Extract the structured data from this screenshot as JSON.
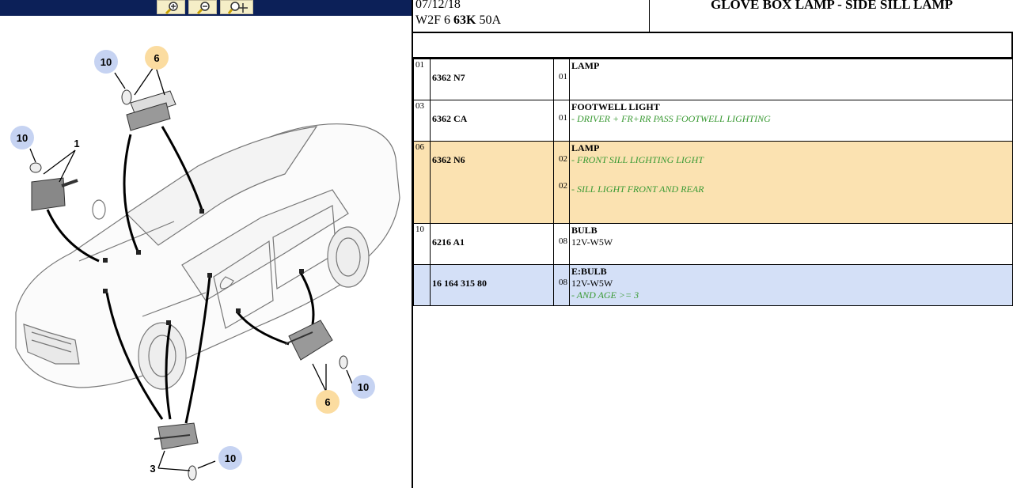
{
  "toolbar": {
    "buttons": [
      {
        "name": "zoom-in-icon"
      },
      {
        "name": "zoom-out-icon"
      },
      {
        "name": "zoom-pan-icon"
      }
    ]
  },
  "diagram": {
    "callouts": [
      {
        "label": "10",
        "style": "blue"
      },
      {
        "label": "6",
        "style": "orange"
      },
      {
        "label": "10",
        "style": "blue"
      },
      {
        "label": "1",
        "style": "plain"
      },
      {
        "label": "10",
        "style": "blue"
      },
      {
        "label": "6",
        "style": "orange"
      },
      {
        "label": "10",
        "style": "blue"
      },
      {
        "label": "3",
        "style": "plain"
      }
    ]
  },
  "header": {
    "date": "07/12/18",
    "code_prefix": "W2F 6 ",
    "code_bold": "63K",
    "code_suffix": " 50A",
    "title": "GLOVE BOX LAMP - SIDE SILL LAMP"
  },
  "parts": [
    {
      "ref": "01",
      "number": "6362 N7",
      "lines": [
        {
          "qty": "01",
          "label": "LAMP",
          "note": ""
        }
      ],
      "highlight": ""
    },
    {
      "ref": "03",
      "number": "6362 CA",
      "lines": [
        {
          "qty": "01",
          "label": "FOOTWELL LIGHT",
          "note": "- DRIVER + FR+RR PASS FOOTWELL LIGHTING"
        }
      ],
      "highlight": ""
    },
    {
      "ref": "06",
      "number": "6362 N6",
      "lines": [
        {
          "qty": "02",
          "label": "LAMP",
          "note": "- FRONT SILL LIGHTING LIGHT"
        },
        {
          "qty": "02",
          "label": "",
          "note": "- SILL LIGHT FRONT AND REAR"
        }
      ],
      "highlight": "orange"
    },
    {
      "ref": "10",
      "number": "6216 A1",
      "lines": [
        {
          "qty": "08",
          "label": "BULB",
          "note": "12V-W5W"
        }
      ],
      "highlight": ""
    },
    {
      "ref": "",
      "number": "16 164 315 80",
      "lines": [
        {
          "qty": "08",
          "label": "E:BULB",
          "note": "12V-W5W",
          "note2": "- AND AGE >= 3"
        }
      ],
      "highlight": "blue"
    }
  ]
}
